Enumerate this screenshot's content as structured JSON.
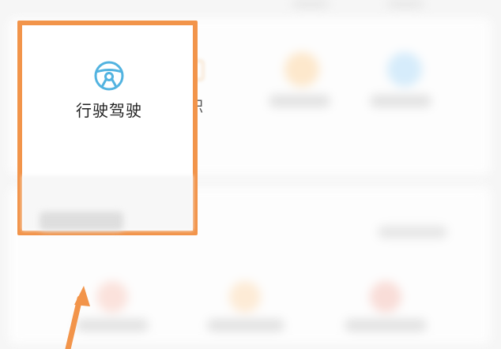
{
  "services": {
    "highlighted": {
      "label": "行驶驾驶",
      "icon": "steering-wheel-icon",
      "icon_color": "#52b3e0"
    },
    "neighbor": {
      "label": "公积"
    }
  },
  "annotation": {
    "color": "#f2944a"
  }
}
